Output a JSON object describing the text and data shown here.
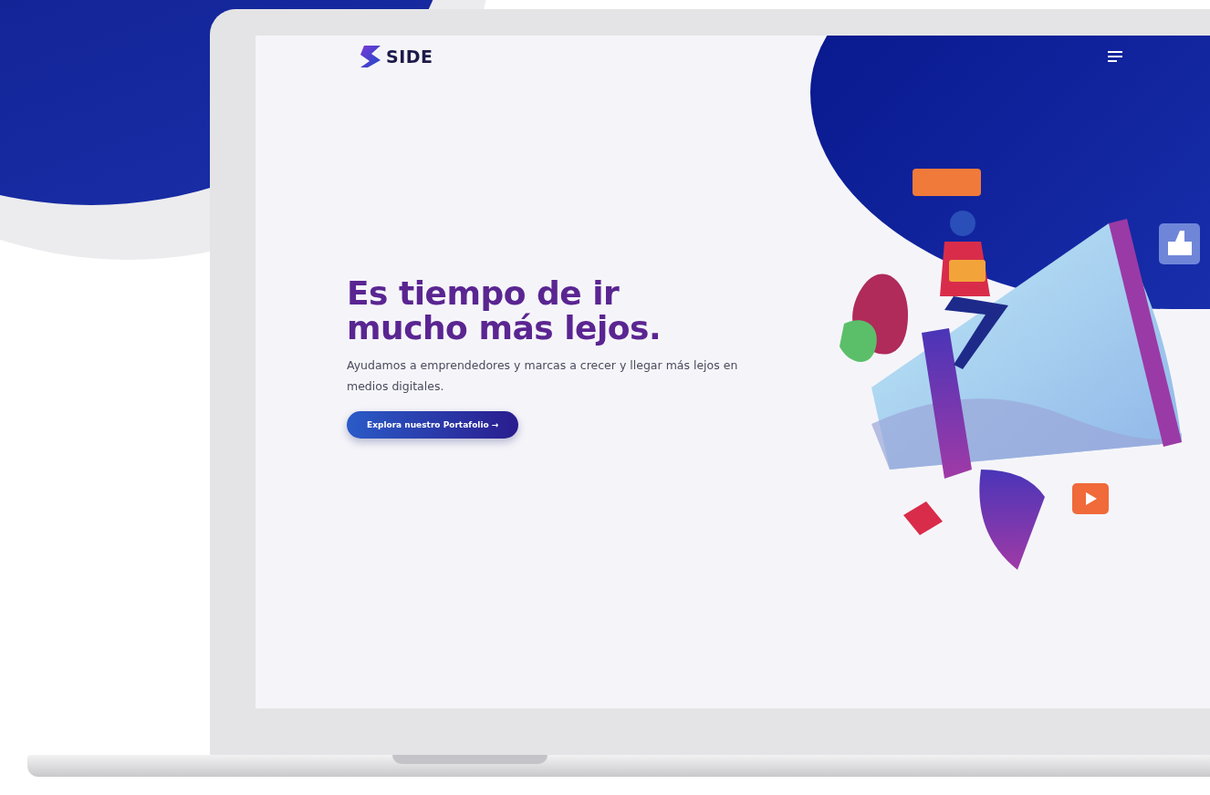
{
  "site": {
    "logo": "SIDE"
  },
  "hero": {
    "heading_lines": [
      "Es tiempo de ir",
      "mucho más lejos."
    ],
    "subtitle": "Ayudamos a emprendedores y marcas a crecer y llegar más lejos en medios digitales.",
    "button": "Explora nuestro Portafolio →"
  }
}
